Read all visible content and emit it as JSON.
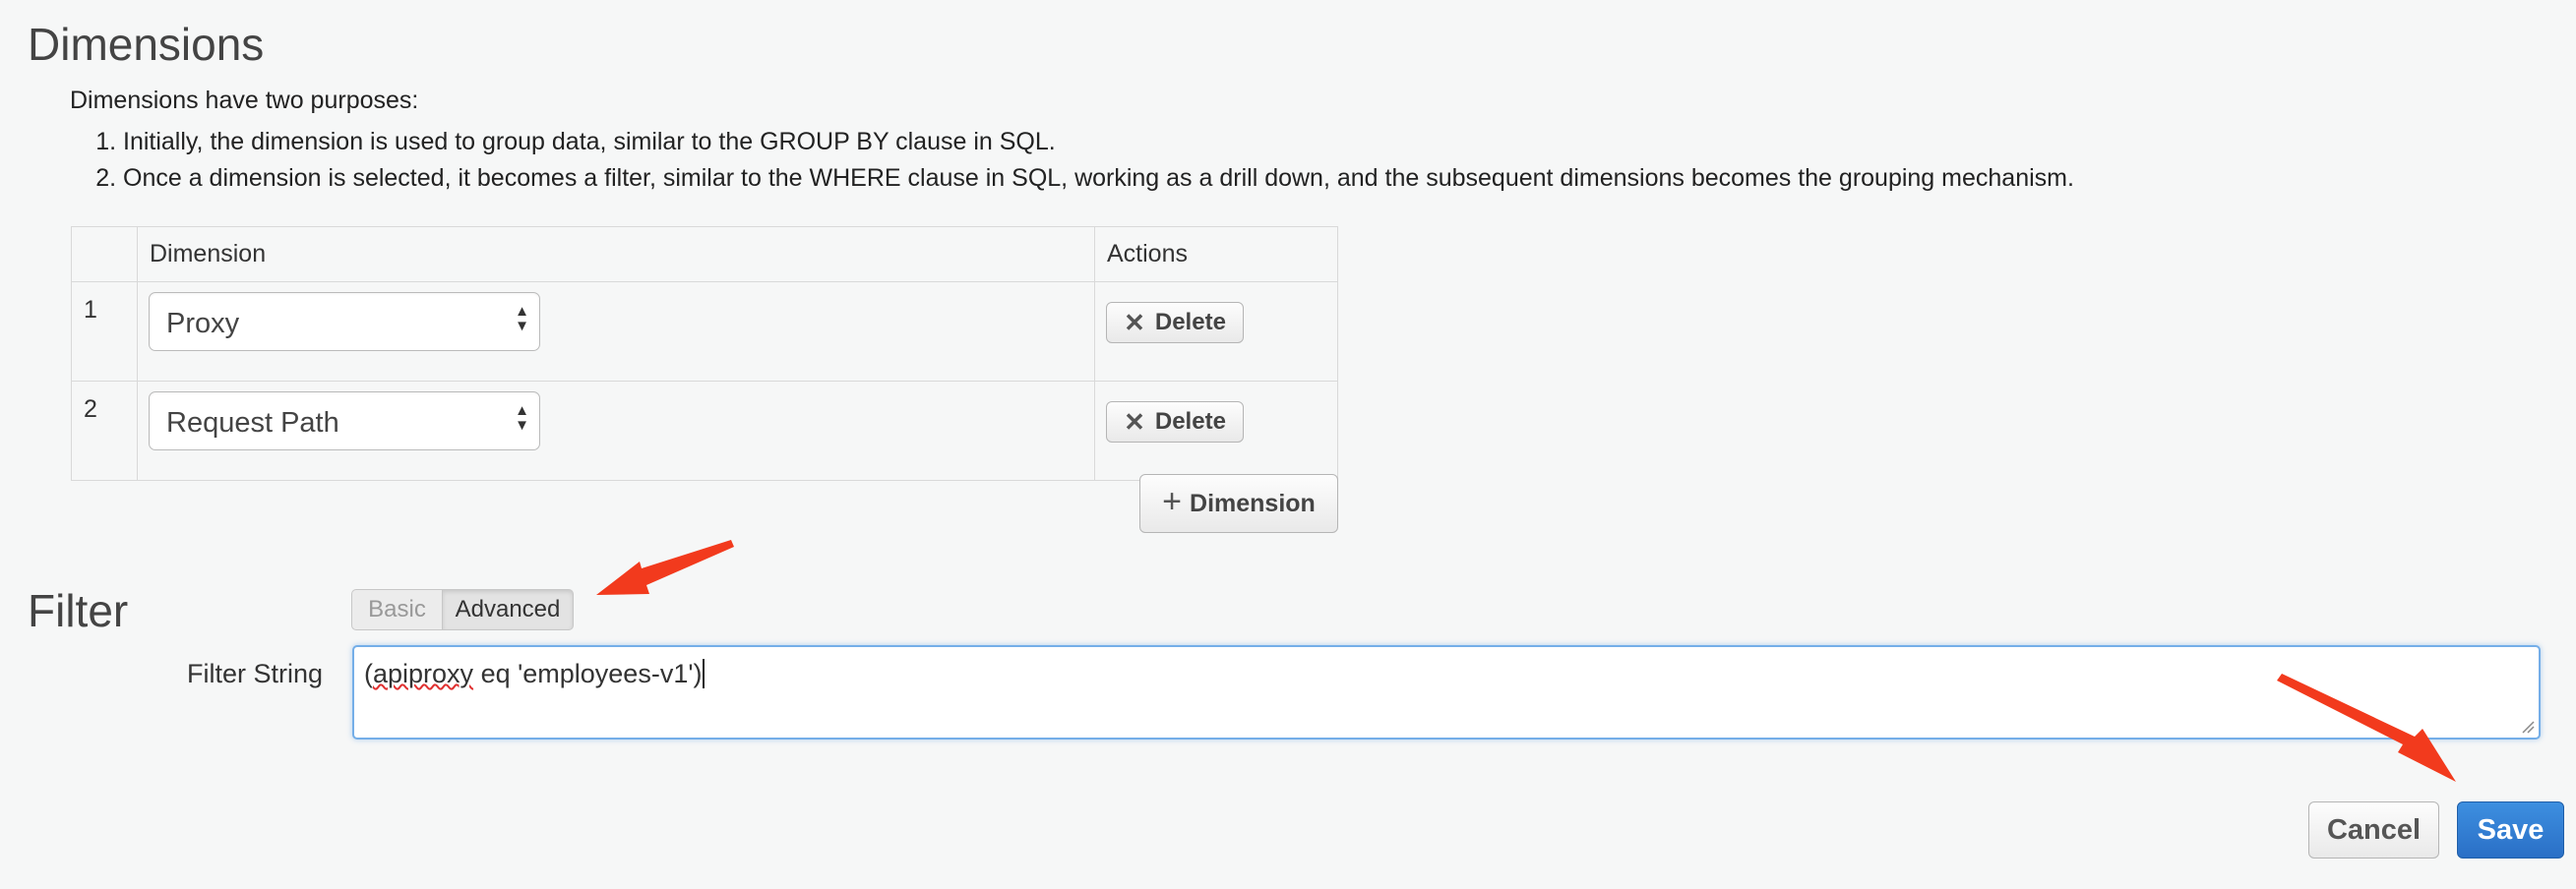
{
  "dimensions": {
    "title": "Dimensions",
    "intro": "Dimensions have two purposes:",
    "purposes": [
      "Initially, the dimension is used to group data, similar to the GROUP BY clause in SQL.",
      "Once a dimension is selected, it becomes a filter, similar to the WHERE clause in SQL, working as a drill down, and the subsequent dimensions becomes the grouping mechanism."
    ],
    "table": {
      "headers": [
        "",
        "Dimension",
        "Actions"
      ],
      "rows": [
        {
          "num": "1",
          "value": "Proxy",
          "action": "Delete"
        },
        {
          "num": "2",
          "value": "Request Path",
          "action": "Delete"
        }
      ]
    },
    "add_button": "Dimension"
  },
  "filter": {
    "title": "Filter",
    "modes": {
      "basic": "Basic",
      "advanced": "Advanced",
      "selected": "Advanced"
    },
    "label": "Filter String",
    "value_prefix": "(",
    "value_misspelled": "apiproxy",
    "value_rest": " eq 'employees-v1')"
  },
  "actions": {
    "cancel": "Cancel",
    "save": "Save"
  },
  "colors": {
    "accent": "#2a6fc6",
    "annotation_arrow": "#f23a1d",
    "focus_border": "#74aee8"
  },
  "icons": {
    "delete": "close-icon",
    "add": "plus-icon",
    "select": "updown-arrows-icon"
  }
}
